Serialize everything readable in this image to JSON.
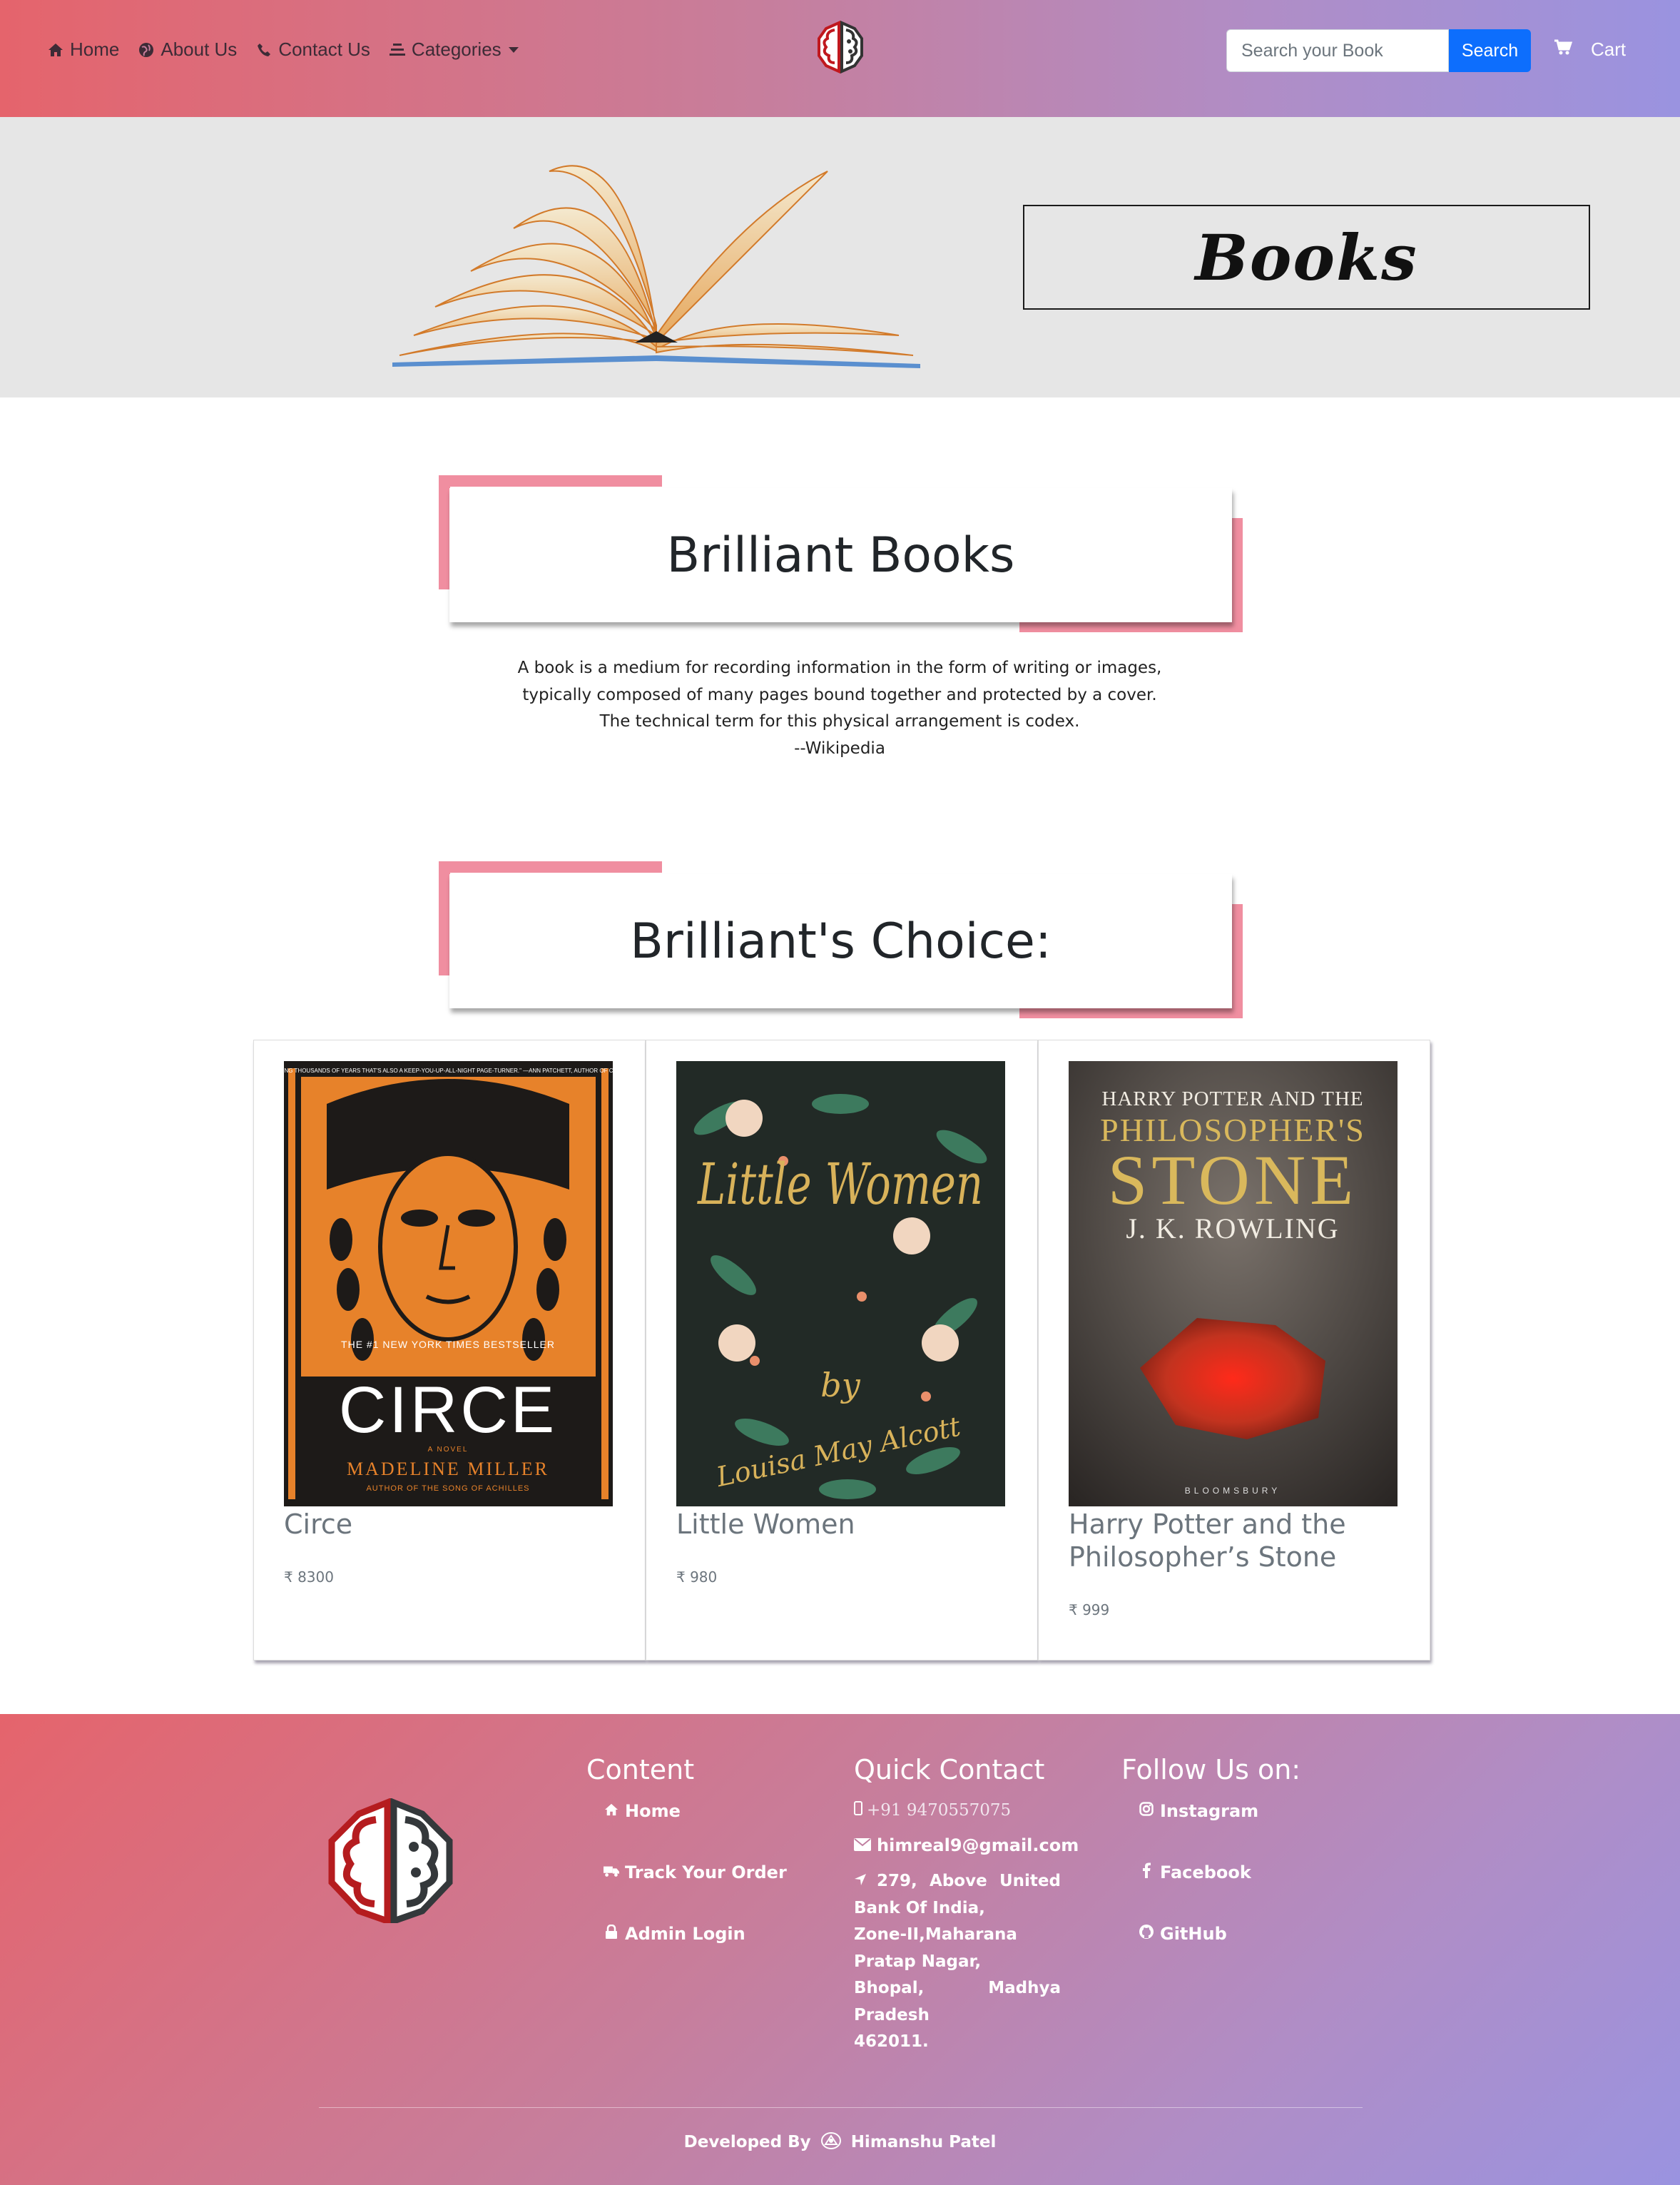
{
  "nav": {
    "links": [
      {
        "label": "Home",
        "icon": "home-icon"
      },
      {
        "label": "About Us",
        "icon": "globe-icon"
      },
      {
        "label": "Contact Us",
        "icon": "phone-icon"
      },
      {
        "label": "Categories",
        "icon": "list-icon"
      }
    ],
    "search": {
      "placeholder": "Search your Book",
      "button_label": "Search"
    },
    "cart_label": "Cart"
  },
  "hero": {
    "title": "Books"
  },
  "intro": {
    "heading": "Brilliant Books",
    "lines": [
      "A book is a medium for recording information in the form of writing or images,",
      "typically composed of many pages bound together and protected by a cover.",
      "The technical term for this physical arrangement is codex.",
      "--Wikipedia"
    ]
  },
  "choice": {
    "heading": "Brilliant's Choice:",
    "books": [
      {
        "title": "Circe",
        "price": "₹ 8300",
        "cover_top": "THE #1 NEW YORK TIMES BESTSELLER",
        "cover_title": "CIRCE",
        "cover_sub": "MADELINE MILLER",
        "cover_note": "AUTHOR OF THE SONG OF ACHILLES",
        "cover_blurb": "\"AN EPIC SPANNING THOUSANDS OF YEARS THAT'S ALSO A KEEP-YOU-UP-ALL-NIGHT PAGE-TURNER.\" —ANN PATCHETT, AUTHOR OF COMMONWEALTH",
        "cover_novel": "A NOVEL"
      },
      {
        "title": "Little Women",
        "price": "₹ 980",
        "cover_title": "Little Women",
        "cover_by": "by",
        "cover_sub": "Louisa May Alcott"
      },
      {
        "title": "Harry Potter and the Philosopher’s Stone",
        "price": "₹ 999",
        "cover_top": "HARRY POTTER AND THE",
        "cover_mid": "PHILOSOPHER'S",
        "cover_title": "STONE",
        "cover_sub": "J. K. ROWLING",
        "cover_note": "BLOOMSBURY"
      }
    ]
  },
  "footer": {
    "content": {
      "heading": "Content",
      "links": [
        {
          "label": "Home",
          "icon": "home-icon"
        },
        {
          "label": "Track Your Order",
          "icon": "truck-icon"
        },
        {
          "label": "Admin Login",
          "icon": "lock-icon"
        }
      ]
    },
    "contact": {
      "heading": "Quick Contact",
      "phone": "+91 9470557075",
      "email": "himreal9@gmail.com",
      "address_lines": [
        "279, Above United",
        "Bank Of India,",
        "Zone-II,Maharana",
        "Pratap Nagar,",
        "Bhopal, Madhya",
        "Pradesh",
        "462011."
      ]
    },
    "follow": {
      "heading": "Follow Us on:",
      "links": [
        {
          "label": "Instagram",
          "icon": "instagram-icon"
        },
        {
          "label": "Facebook",
          "icon": "facebook-icon"
        },
        {
          "label": "GitHub",
          "icon": "github-icon"
        }
      ]
    },
    "credit_prefix": "Developed By",
    "credit_name": "Himanshu Patel"
  },
  "colors": {
    "accent_pink": "#f08ea0",
    "search_blue": "#0d6efd",
    "gradient_start": "#e5646c",
    "gradient_end": "#9a93e0"
  }
}
